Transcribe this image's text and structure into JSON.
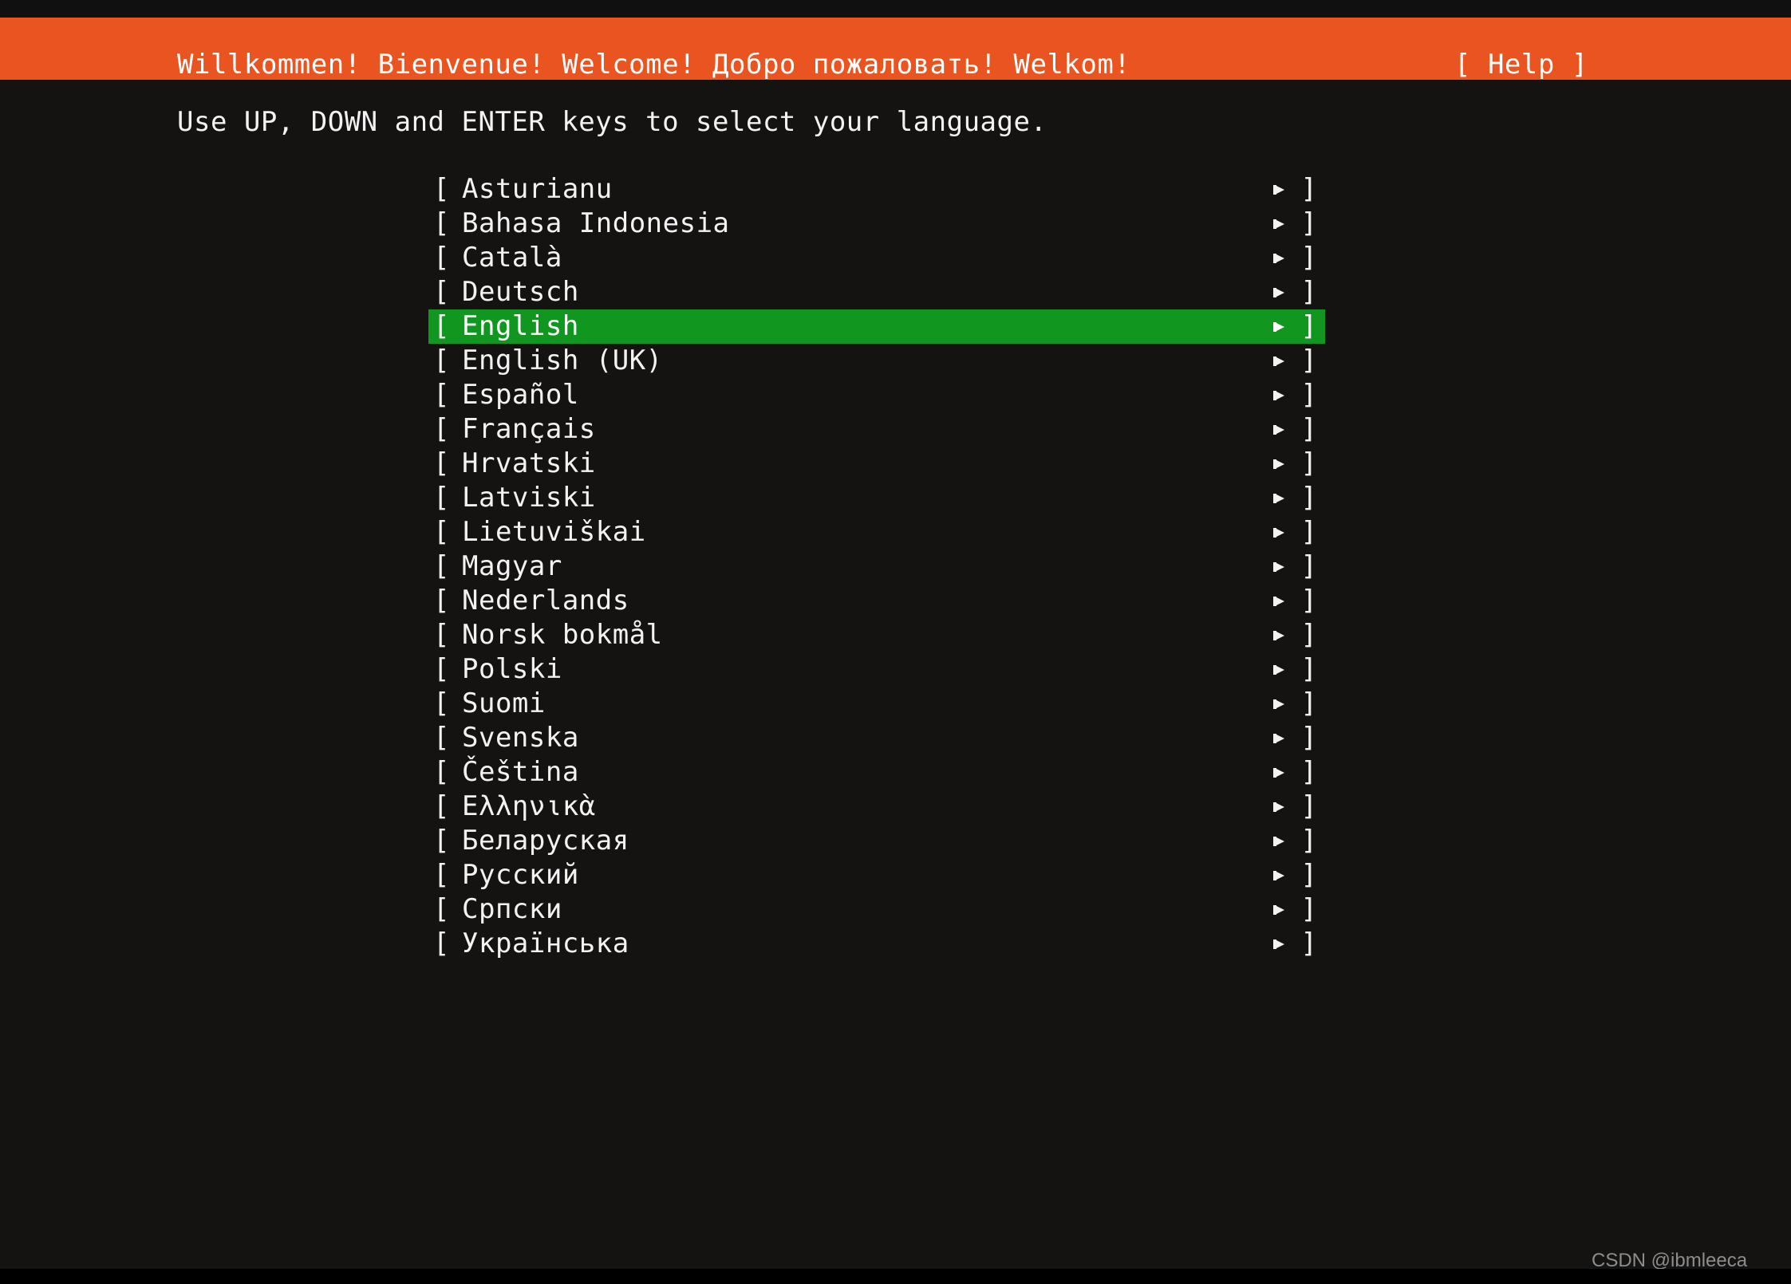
{
  "colors": {
    "header_background": "#e95420",
    "screen_background": "#151312",
    "selection_background": "#11971f",
    "text_primary": "#f2f2f2",
    "text_on_header": "#ffffff",
    "watermark": "#8c8c8c"
  },
  "header": {
    "welcome_text": "Willkommen! Bienvenue! Welcome! Добро пожаловать! Welkom!",
    "help_label": "[ Help ]",
    "help_icon": "help-label"
  },
  "instruction": {
    "text": "Use UP, DOWN and ENTER keys to select your language."
  },
  "list": {
    "bracket_open": "[",
    "bracket_close": "]",
    "marker_icon": "submenu-arrow-icon",
    "selected_index": 4,
    "items": [
      {
        "label": "Asturianu",
        "selected": false
      },
      {
        "label": "Bahasa Indonesia",
        "selected": false
      },
      {
        "label": "Català",
        "selected": false
      },
      {
        "label": "Deutsch",
        "selected": false
      },
      {
        "label": "English",
        "selected": true
      },
      {
        "label": "English (UK)",
        "selected": false
      },
      {
        "label": "Español",
        "selected": false
      },
      {
        "label": "Français",
        "selected": false
      },
      {
        "label": "Hrvatski",
        "selected": false
      },
      {
        "label": "Latviski",
        "selected": false
      },
      {
        "label": "Lietuviškai",
        "selected": false
      },
      {
        "label": "Magyar",
        "selected": false
      },
      {
        "label": "Nederlands",
        "selected": false
      },
      {
        "label": "Norsk bokmål",
        "selected": false
      },
      {
        "label": "Polski",
        "selected": false
      },
      {
        "label": "Suomi",
        "selected": false
      },
      {
        "label": "Svenska",
        "selected": false
      },
      {
        "label": "Čeština",
        "selected": false
      },
      {
        "label": "Ελληνικὰ",
        "selected": false
      },
      {
        "label": "Беларуская",
        "selected": false
      },
      {
        "label": "Русский",
        "selected": false
      },
      {
        "label": "Српски",
        "selected": false
      },
      {
        "label": "Українська",
        "selected": false
      }
    ]
  },
  "watermark": {
    "text": "CSDN @ibmleeca"
  }
}
